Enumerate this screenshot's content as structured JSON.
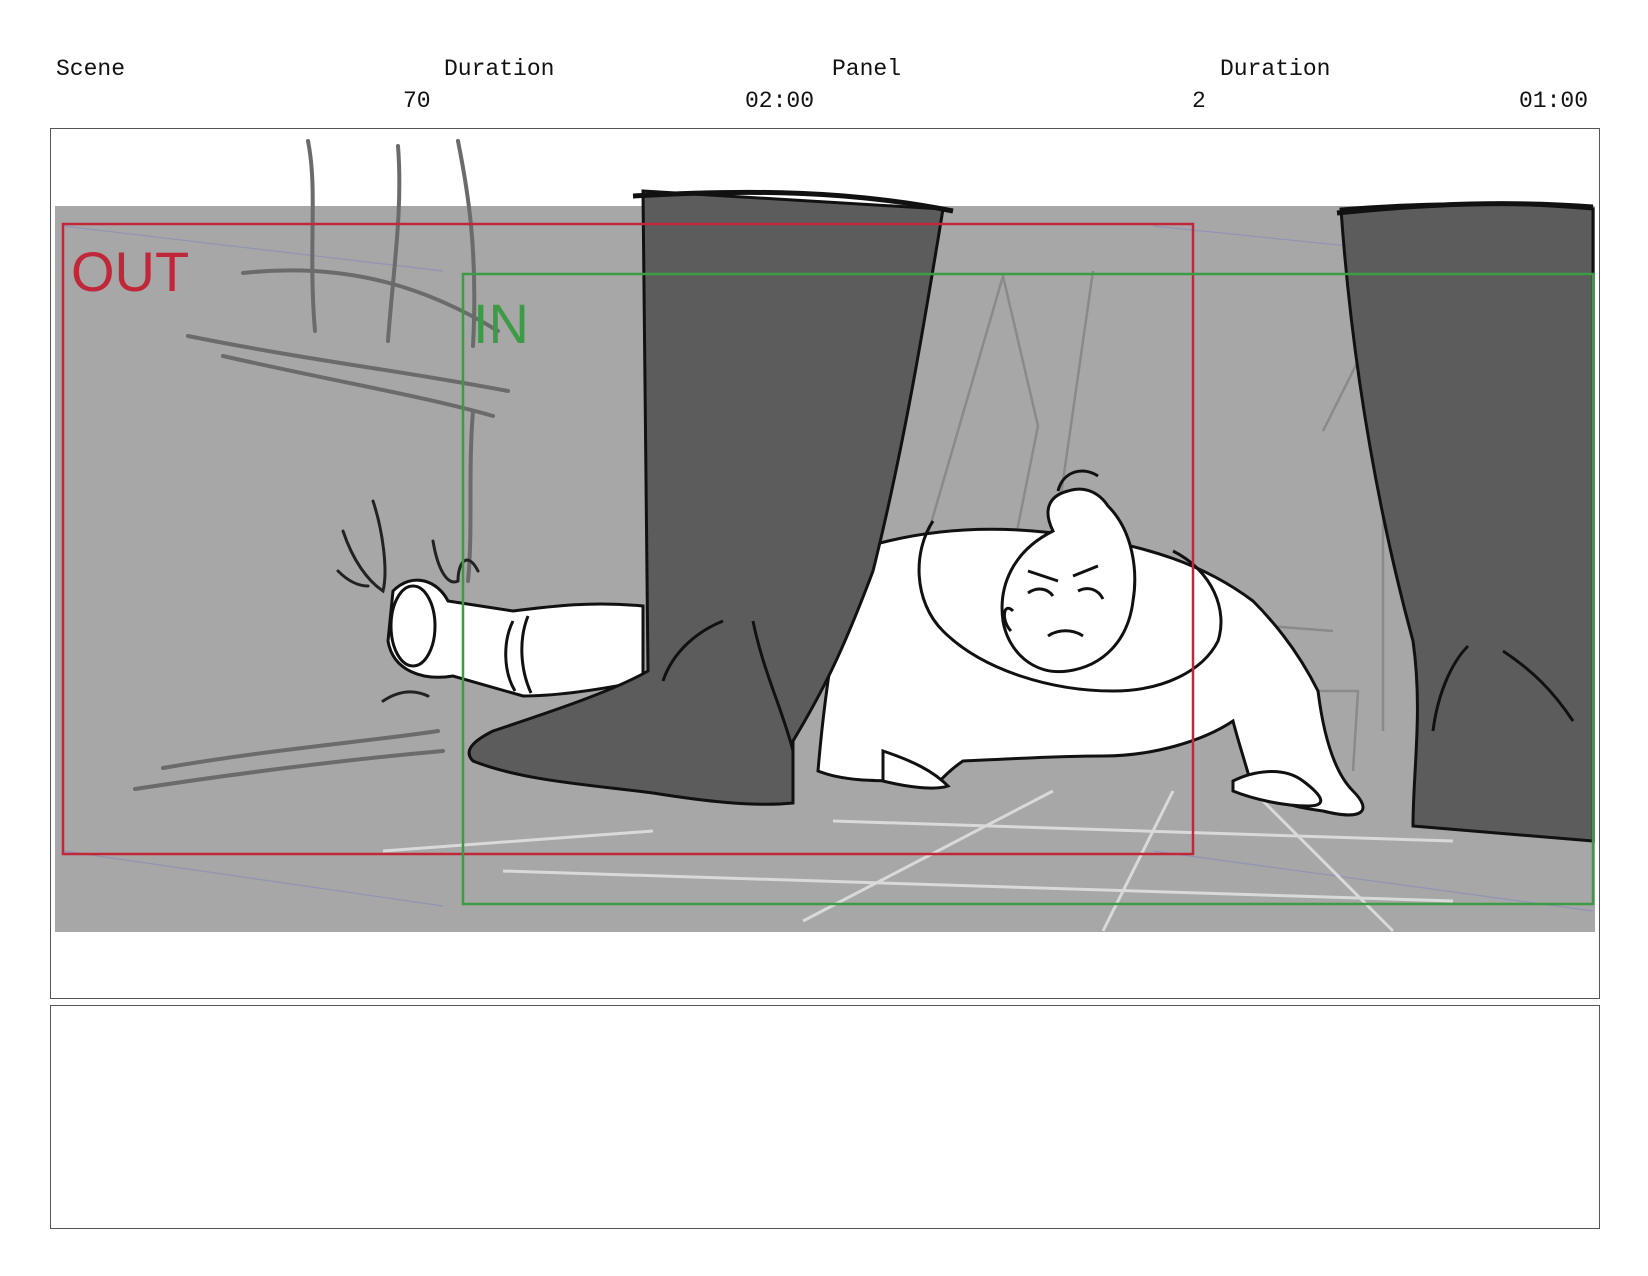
{
  "header": {
    "scene_label": "Scene",
    "duration_label_1": "Duration",
    "panel_label": "Panel",
    "duration_label_2": "Duration",
    "scene_value": "70",
    "duration_value_1": "02:00",
    "panel_value": "2",
    "duration_value_2": "01:00"
  },
  "panel": {
    "out_label": "OUT",
    "in_label": "IN",
    "colors": {
      "background": "#a7a7a7",
      "out_frame": "#c0283a",
      "in_frame": "#3d9a45",
      "boot": "#5c5c5c",
      "floor_lines": "#d9d9d9"
    }
  },
  "notes": {
    "text": ""
  }
}
